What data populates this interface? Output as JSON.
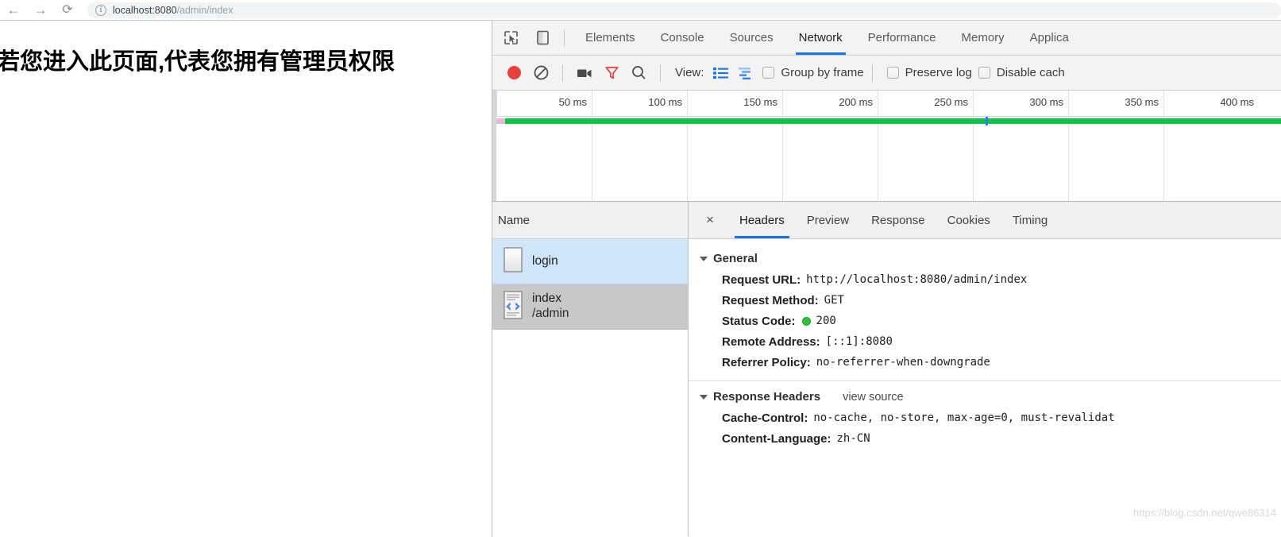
{
  "browser": {
    "back_icon": "arrow-left-icon",
    "forward_icon": "arrow-right-icon",
    "reload_icon": "reload-icon",
    "info_glyph": "i",
    "url_host": "localhost:8080",
    "url_path": "/admin/index"
  },
  "page": {
    "heading": "若您进入此页面,代表您拥有管理员权限"
  },
  "devtools": {
    "tabs": [
      {
        "label": "Elements",
        "active": false
      },
      {
        "label": "Console",
        "active": false
      },
      {
        "label": "Sources",
        "active": false
      },
      {
        "label": "Network",
        "active": true
      },
      {
        "label": "Performance",
        "active": false
      },
      {
        "label": "Memory",
        "active": false
      },
      {
        "label": "Applica",
        "active": false
      }
    ],
    "toolbar": {
      "record_title": "record-button",
      "clear_title": "clear-button",
      "camera_title": "capture-screenshots-button",
      "filter_title": "filter-button",
      "search_title": "search-button",
      "view_label": "View:",
      "list_view_title": "list-view-button",
      "waterfall_view_title": "waterfall-view-button",
      "checkboxes": [
        {
          "label": "Group by frame",
          "checked": false
        },
        {
          "label": "Preserve log",
          "checked": false
        },
        {
          "label": "Disable cach",
          "checked": false
        }
      ]
    },
    "overview": {
      "ticks": [
        "50 ms",
        "100 ms",
        "150 ms",
        "200 ms",
        "250 ms",
        "300 ms",
        "350 ms",
        "400 ms"
      ],
      "bar_color": "#13c24b",
      "marker_color": "#2d7ff9"
    },
    "name_panel": {
      "header": "Name",
      "rows": [
        {
          "name": "login",
          "sub": "",
          "icon": "blank-document-icon",
          "state": "selected-blue"
        },
        {
          "name": "index",
          "sub": "/admin",
          "icon": "code-document-icon",
          "state": "selected-gray"
        }
      ]
    },
    "detail": {
      "close_label": "×",
      "tabs": [
        {
          "label": "Headers",
          "active": true
        },
        {
          "label": "Preview",
          "active": false
        },
        {
          "label": "Response",
          "active": false
        },
        {
          "label": "Cookies",
          "active": false
        },
        {
          "label": "Timing",
          "active": false
        }
      ],
      "general": {
        "title": "General",
        "rows": [
          {
            "key": "Request URL:",
            "value": "http://localhost:8080/admin/index",
            "status": false
          },
          {
            "key": "Request Method:",
            "value": "GET",
            "status": false
          },
          {
            "key": "Status Code:",
            "value": "200",
            "status": true
          },
          {
            "key": "Remote Address:",
            "value": "[::1]:8080",
            "status": false
          },
          {
            "key": "Referrer Policy:",
            "value": "no-referrer-when-downgrade",
            "status": false
          }
        ]
      },
      "response_headers": {
        "title": "Response Headers",
        "view_source": "view source",
        "rows": [
          {
            "key": "Cache-Control:",
            "value": "no-cache, no-store, max-age=0, must-revalidat"
          },
          {
            "key": "Content-Language:",
            "value": "zh-CN"
          }
        ]
      }
    }
  },
  "watermark": "https://blog.csdn.net/qwe86314"
}
